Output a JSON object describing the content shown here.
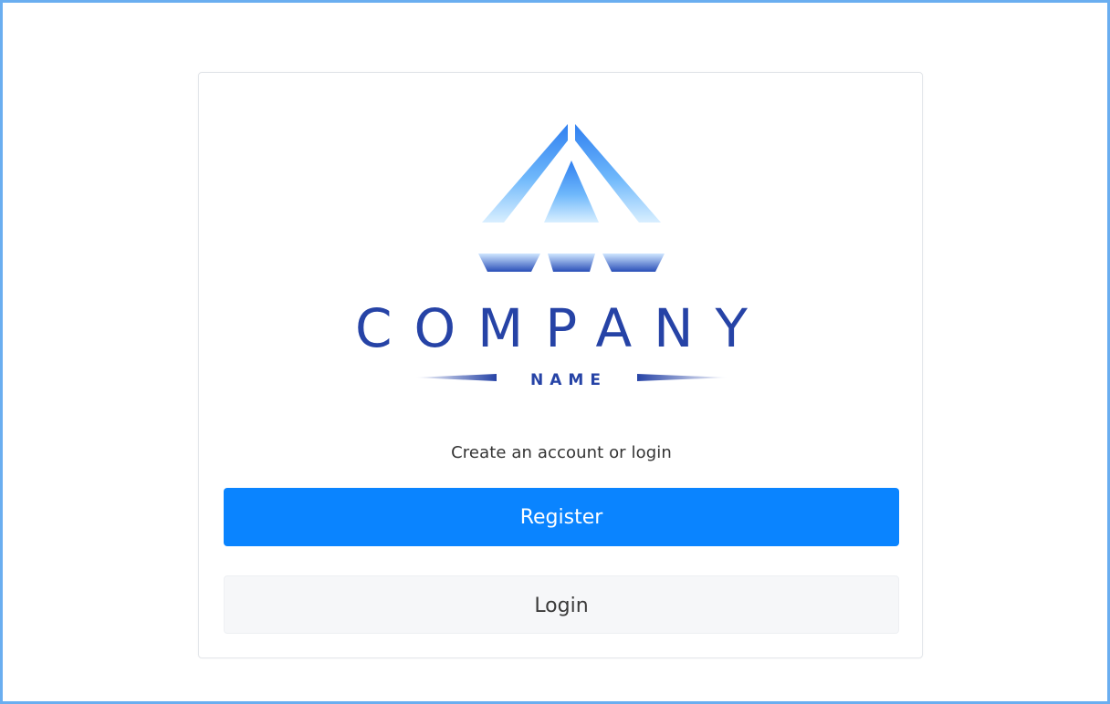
{
  "logo": {
    "text_main": "COMPANY",
    "text_sub": "NAME",
    "color_primary": "#2643a6",
    "color_light": "#7fc4ff"
  },
  "prompt": "Create an account or login",
  "buttons": {
    "register_label": "Register",
    "login_label": "Login"
  },
  "colors": {
    "accent": "#0a84ff",
    "frame": "#6aaef0"
  }
}
